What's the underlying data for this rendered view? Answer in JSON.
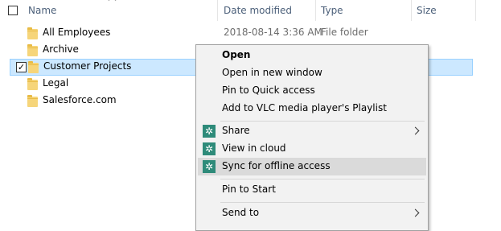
{
  "columns": {
    "name": "Name",
    "date_modified": "Date modified",
    "type": "Type",
    "size": "Size"
  },
  "files": [
    {
      "name": "All Employees",
      "date": "2018-08-14 3:36 AM",
      "type": "File folder",
      "selected": false
    },
    {
      "name": "Archive",
      "date": "",
      "type": "",
      "selected": false
    },
    {
      "name": "Customer Projects",
      "date": "",
      "type": "",
      "selected": true,
      "check_mark": "✓"
    },
    {
      "name": "Legal",
      "date": "",
      "type": "",
      "selected": false
    },
    {
      "name": "Salesforce.com",
      "date": "",
      "type": "",
      "selected": false
    }
  ],
  "context_menu": {
    "open": "Open",
    "open_new_window": "Open in new window",
    "pin_quick_access": "Pin to Quick access",
    "add_vlc": "Add to VLC media player's Playlist",
    "share": "Share",
    "view_in_cloud": "View in cloud",
    "sync_offline": "Sync for offline access",
    "pin_to_start": "Pin to Start",
    "send_to": "Send to",
    "icon_glyph": "✲",
    "icon_color": "#2e8b7a",
    "hovered_item": "Sync for offline access"
  },
  "colors": {
    "selection_bg": "#cce8ff",
    "selection_border": "#99d1ff",
    "header_text": "#4c607a",
    "menu_bg": "#f2f2f2",
    "menu_hover": "#dadada"
  }
}
